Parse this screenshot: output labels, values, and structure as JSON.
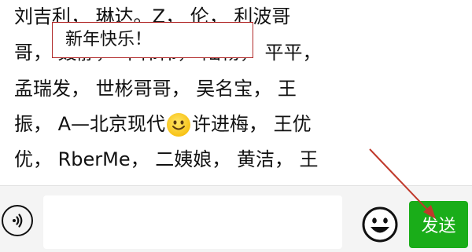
{
  "message": {
    "lines": [
      "刘吉利， 琳达。Z， 伦， 利波哥",
      "哥， 聂静， 毕伟伟， 陆畅， 平平，",
      "孟瑞发， 世彬哥哥， 吴名宝， 王",
      [
        "振， A—北京现代",
        "许进梅， 王优"
      ],
      "优， RberMe， 二姨娘， 黄洁， 王"
    ]
  },
  "input": {
    "value": "新年快乐！"
  },
  "send_button": {
    "label": "发送"
  },
  "colors": {
    "send_bg": "#1aad19",
    "annotation": "#c0392b",
    "input_border": "#b12a2a"
  },
  "icons": {
    "voice": "voice-icon",
    "emoji_inline": "smiley-emoji",
    "emoji_button": "emoji-icon"
  }
}
